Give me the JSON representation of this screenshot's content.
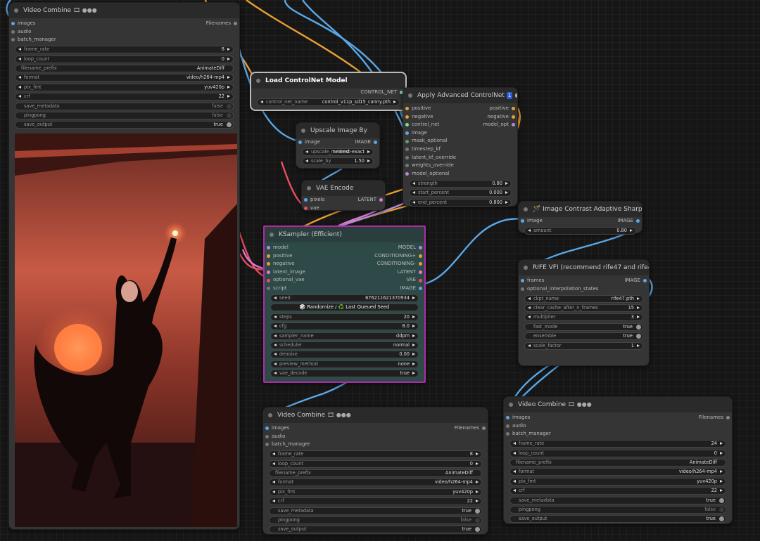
{
  "colors": {
    "canvas_bg": "#161616",
    "node_bg": "#353535",
    "ksampler_border": "#b02aa7",
    "ksampler_bg": "#2d4a48",
    "wire_orange": "#e8a030",
    "wire_blue": "#5aa8e8",
    "wire_pink": "#e07ad8",
    "wire_red": "#e85060"
  },
  "video_combine_1": {
    "title": "Video Combine",
    "badge": "🎞 ●●●",
    "in": [
      "images",
      "audio",
      "batch_manager"
    ],
    "out": "Filenames",
    "widgets": [
      {
        "label": "frame_rate",
        "value": "8"
      },
      {
        "label": "loop_count",
        "value": "0"
      },
      {
        "label": "filename_prefix",
        "value": "AnimateDiff"
      },
      {
        "label": "format",
        "value": "video/h264-mp4"
      },
      {
        "label": "pix_fmt",
        "value": "yuv420p"
      },
      {
        "label": "crf",
        "value": "22"
      },
      {
        "label": "save_metadata",
        "value": "false"
      },
      {
        "label": "pingpong",
        "value": "false"
      },
      {
        "label": "save_output",
        "value": "true"
      }
    ]
  },
  "load_controlnet": {
    "title": "Load ControlNet Model",
    "out": "CONTROL_NET",
    "widget": {
      "label": "control_net_name",
      "value": "control_v11p_sd15_canny.pth"
    }
  },
  "apply_controlnet": {
    "title": "Apply Advanced ControlNet",
    "badge_num": "1",
    "badge_dots": "●●●",
    "in": [
      "positive",
      "negative",
      "control_net",
      "image",
      "mask_optional",
      "timestep_kf",
      "latent_kf_override",
      "weights_override",
      "model_optional"
    ],
    "out": [
      "positive",
      "negative",
      "model_opt"
    ],
    "widgets": [
      {
        "label": "strength",
        "value": "0.80"
      },
      {
        "label": "start_percent",
        "value": "0.000"
      },
      {
        "label": "end_percent",
        "value": "0.800"
      }
    ]
  },
  "upscale": {
    "title": "Upscale Image By",
    "in": "image",
    "out": "IMAGE",
    "widgets": [
      {
        "label": "upscale_method",
        "value": "nearest-exact"
      },
      {
        "label": "scale_by",
        "value": "1.50"
      }
    ]
  },
  "vae_encode": {
    "title": "VAE Encode",
    "in": [
      "pixels",
      "vae"
    ],
    "out": "LATENT"
  },
  "ksampler": {
    "title": "KSampler (Efficient)",
    "in": [
      "model",
      "positive",
      "negative",
      "latent_image",
      "optional_vae",
      "script"
    ],
    "out": [
      "MODEL",
      "CONDITIONING+",
      "CONDITIONING-",
      "LATENT",
      "VAE",
      "IMAGE"
    ],
    "seed": {
      "label": "seed",
      "value": "676211621370934"
    },
    "seed_button": "🎲 Randomize / ♻️ Last Queued Seed",
    "widgets": [
      {
        "label": "steps",
        "value": "20"
      },
      {
        "label": "cfg",
        "value": "8.0"
      },
      {
        "label": "sampler_name",
        "value": "ddpm"
      },
      {
        "label": "scheduler",
        "value": "normal"
      },
      {
        "label": "denoise",
        "value": "0.00"
      },
      {
        "label": "preview_method",
        "value": "none"
      },
      {
        "label": "vae_decode",
        "value": "true"
      }
    ]
  },
  "sharpen": {
    "title": "Image Contrast Adaptive Sharpening",
    "icon": "🪄",
    "in": "image",
    "out": "IMAGE",
    "widget": {
      "label": "amount",
      "value": "0.80"
    }
  },
  "rife": {
    "title": "RIFE VFI (recommend rife47 and rife49)",
    "in": [
      "frames",
      "optional_interpolation_states"
    ],
    "out": "IMAGE",
    "widgets": [
      {
        "label": "ckpt_name",
        "value": "rife47.pth"
      },
      {
        "label": "clear_cache_after_n_frames",
        "value": "15"
      },
      {
        "label": "multiplier",
        "value": "3"
      },
      {
        "label": "fast_mode",
        "value": "true"
      },
      {
        "label": "ensemble",
        "value": "true"
      },
      {
        "label": "scale_factor",
        "value": "1"
      }
    ]
  },
  "video_combine_2": {
    "title": "Video Combine",
    "badge": "🎞 ●●●",
    "in": [
      "images",
      "audio",
      "batch_manager"
    ],
    "out": "Filenames",
    "widgets": [
      {
        "label": "frame_rate",
        "value": "8"
      },
      {
        "label": "loop_count",
        "value": "0"
      },
      {
        "label": "filename_prefix",
        "value": "AnimateDiff"
      },
      {
        "label": "format",
        "value": "video/h264-mp4"
      },
      {
        "label": "pix_fmt",
        "value": "yuv420p"
      },
      {
        "label": "crf",
        "value": "22"
      },
      {
        "label": "save_metadata",
        "value": "true"
      },
      {
        "label": "pingpong",
        "value": "false"
      },
      {
        "label": "save_output",
        "value": "true"
      }
    ]
  },
  "video_combine_3": {
    "title": "Video Combine",
    "badge": "🎞 ●●●",
    "in": [
      "images",
      "audio",
      "batch_manager"
    ],
    "out": "Filenames",
    "widgets": [
      {
        "label": "frame_rate",
        "value": "24"
      },
      {
        "label": "loop_count",
        "value": "0"
      },
      {
        "label": "filename_prefix",
        "value": "AnimateDiff"
      },
      {
        "label": "format",
        "value": "video/h264-mp4"
      },
      {
        "label": "pix_fmt",
        "value": "yuv420p"
      },
      {
        "label": "crf",
        "value": "22"
      },
      {
        "label": "save_metadata",
        "value": "true"
      },
      {
        "label": "pingpong",
        "value": "false"
      },
      {
        "label": "save_output",
        "value": "true"
      }
    ]
  }
}
